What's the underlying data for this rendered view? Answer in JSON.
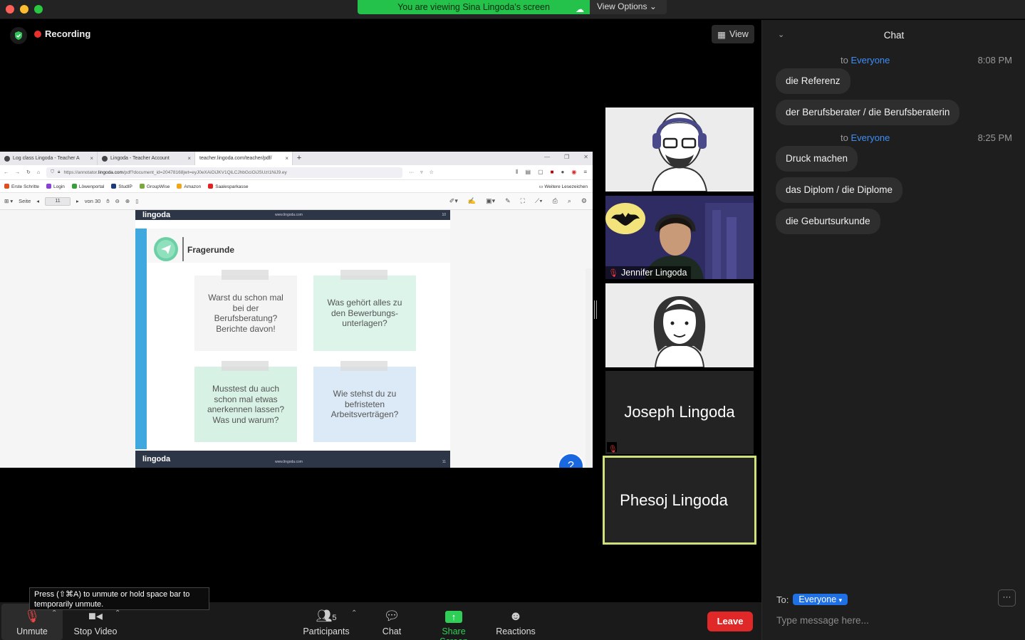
{
  "titlebar": {
    "viewing_banner": "You are viewing Sina Lingoda's screen",
    "view_options": "View Options"
  },
  "meeting": {
    "recording_label": "Recording",
    "view_button": "View"
  },
  "browser": {
    "tabs": [
      {
        "label": "Log class Lingoda - Teacher A",
        "close": "×"
      },
      {
        "label": "Lingoda - Teacher Account",
        "close": "×"
      },
      {
        "label": "teacher.lingoda.com/teacher/pdf/",
        "close": "×"
      }
    ],
    "new_tab": "+",
    "url_prefix": "https://annotator.",
    "url_host": "lingoda.com",
    "url_rest": "/pdf?document_id=20478168jwt=eyJ0eXAiOiJKV1QiLCJhbGciOiJSUzI1NiJ9.ey",
    "bookmarks": [
      {
        "label": "Erste Schritte",
        "color": "#e24c1f"
      },
      {
        "label": "Login",
        "color": "#8a3fd8"
      },
      {
        "label": "Löwenportal",
        "color": "#3a9e3a"
      },
      {
        "label": "StudIP",
        "color": "#1d3a7a"
      },
      {
        "label": "GroupWise",
        "color": "#7aa83a"
      },
      {
        "label": "Amazon",
        "color": "#f3a517"
      },
      {
        "label": "Saalesparkasse",
        "color": "#e52020"
      }
    ],
    "bookmarks_more": "Weitere Lesezeichen",
    "pdf_toolbar": {
      "page_label": "Seite",
      "page_number": "11",
      "page_total": "von 30"
    }
  },
  "pdf": {
    "brand": "lingoda",
    "site": "www.lingoda.com",
    "prev_page_number": "10",
    "next_page_number": "11",
    "section_title": "Fragerunde",
    "cards": [
      {
        "text": "Warst du schon mal bei der Berufsberatung? Berichte davon!",
        "color": "#f4f4f4"
      },
      {
        "text": "Was gehört alles zu den Bewerbungs-unterlagen?",
        "color": "#dcf4ea"
      },
      {
        "text": "Musstest du auch schon mal etwas anerkennen lassen? Was und warum?",
        "color": "#d7f1e5"
      },
      {
        "text": "Wie stehst du zu befristeten Arbeitsverträgen?",
        "color": "#dbeaf6"
      }
    ],
    "help_glyph": "?"
  },
  "participants_tiles": [
    {
      "name": ""
    },
    {
      "name": "Jennifer Lingoda"
    },
    {
      "name": ""
    },
    {
      "name": "Joseph Lingoda"
    },
    {
      "name": "Phesoj Lingoda"
    }
  ],
  "toolbar": {
    "unmute": "Unmute",
    "stop_video": "Stop Video",
    "participants": "Participants",
    "participants_count": "5",
    "chat": "Chat",
    "share_screen": "Share Screen",
    "reactions": "Reactions",
    "leave": "Leave",
    "tooltip": "Press  (⇧⌘A) to unmute or hold space bar to temporarily unmute."
  },
  "chat": {
    "title": "Chat",
    "groups": [
      {
        "to_prefix": "to",
        "to": "Everyone",
        "time": "8:08 PM",
        "messages": [
          "die Referenz",
          "der Berufsberater / die Berufsberaterin"
        ]
      },
      {
        "to_prefix": "to",
        "to": "Everyone",
        "time": "8:25 PM",
        "messages": [
          "Druck machen",
          "das Diplom / die Diplome",
          "die Geburtsurkunde"
        ]
      }
    ],
    "to_label": "To:",
    "recipient": "Everyone",
    "more": "···",
    "input_placeholder": "Type message here..."
  }
}
